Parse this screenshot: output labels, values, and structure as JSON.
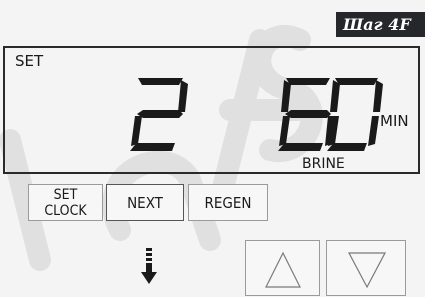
{
  "step_badge": "Шаг 4F",
  "display": {
    "set_label": "SET",
    "digit_left": "2",
    "digit_right": "60",
    "unit": "MIN",
    "mode": "BRINE"
  },
  "buttons": {
    "set_clock": [
      "SET",
      "CLOCK"
    ],
    "next": "NEXT",
    "regen": "REGEN"
  },
  "icons": {
    "down_arrow": "down-arrow-icon",
    "up_button": "triangle-up-icon",
    "down_button": "triangle-down-icon"
  }
}
